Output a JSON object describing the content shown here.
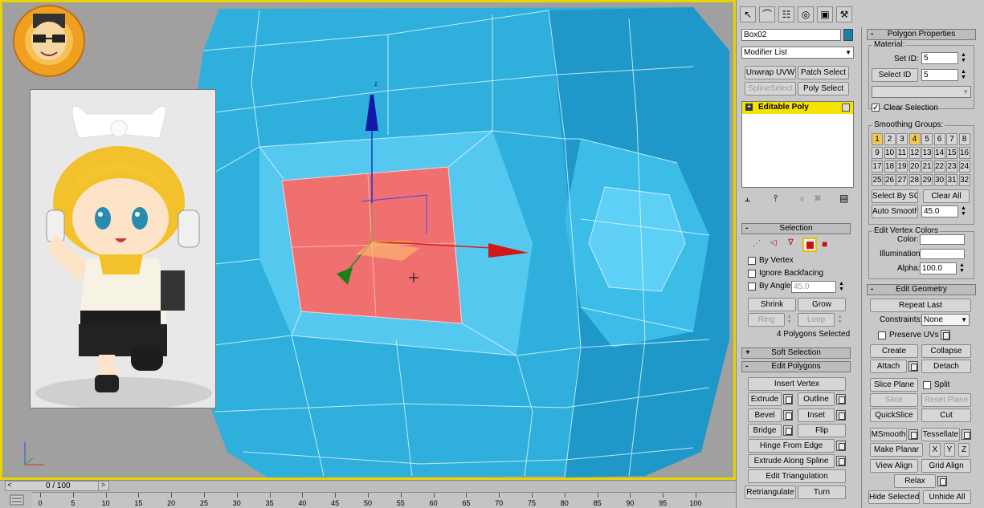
{
  "colors": {
    "mesh": "#2fb0dc",
    "mesh_dark": "#1e8fc0",
    "selected_polys": "#f07070",
    "viewport_border": "#e8d400",
    "object_color": "#1b7fa8",
    "stack_highlight": "#f4e200"
  },
  "timeline": {
    "slider_value": "0 / 100",
    "ticks": [
      "0",
      "5",
      "10",
      "15",
      "20",
      "25",
      "30",
      "35",
      "40",
      "45",
      "50",
      "55",
      "60",
      "65",
      "70",
      "75",
      "80",
      "85",
      "90",
      "95",
      "100"
    ]
  },
  "command_panel": {
    "object_name": "Box02",
    "modifier_list": "Modifier List",
    "buttons": {
      "unwrap_uvw": "Unwrap UVW",
      "patch_select": "Patch Select",
      "spline_select": "SplineSelect",
      "poly_select": "Poly Select"
    },
    "stack_item": "Editable Poly",
    "selection": {
      "title": "Selection",
      "by_vertex": "By Vertex",
      "ignore_backfacing": "Ignore Backfacing",
      "by_angle": "By Angle:",
      "by_angle_value": "45.0",
      "shrink": "Shrink",
      "grow": "Grow",
      "ring": "Ring",
      "loop": "Loop",
      "status": "4 Polygons Selected"
    },
    "soft_selection": "Soft Selection",
    "edit_polygons": {
      "title": "Edit Polygons",
      "insert_vertex": "Insert Vertex",
      "extrude": "Extrude",
      "outline": "Outline",
      "bevel": "Bevel",
      "inset": "Inset",
      "bridge": "Bridge",
      "flip": "Flip",
      "hinge_from_edge": "Hinge From Edge",
      "extrude_along_spline": "Extrude Along Spline",
      "edit_triangulation": "Edit Triangulation",
      "retriangulate": "Retriangulate",
      "turn": "Turn"
    }
  },
  "properties": {
    "polygon_properties": "Polygon Properties",
    "material": "Material:",
    "set_id": "Set ID:",
    "set_id_value": "5",
    "select_id": "Select ID",
    "select_id_value": "5",
    "clear_selection": "Clear Selection",
    "smoothing_groups": "Smoothing Groups:",
    "sg_numbers": [
      "1",
      "2",
      "3",
      "4",
      "5",
      "6",
      "7",
      "8",
      "9",
      "10",
      "11",
      "12",
      "13",
      "14",
      "15",
      "16",
      "17",
      "18",
      "19",
      "20",
      "21",
      "22",
      "23",
      "24",
      "25",
      "26",
      "27",
      "28",
      "29",
      "30",
      "31",
      "32"
    ],
    "sg_active": [
      "1",
      "4"
    ],
    "select_by_sg": "Select By SG",
    "clear_all": "Clear All",
    "auto_smooth": "Auto Smooth",
    "auto_smooth_value": "45.0",
    "edit_vertex_colors": "Edit Vertex Colors",
    "color": "Color:",
    "illumination": "Illumination:",
    "alpha": "Alpha:",
    "alpha_value": "100.0",
    "edit_geometry": "Edit Geometry",
    "repeat_last": "Repeat Last",
    "constraints": "Constraints:",
    "constraints_value": "None",
    "preserve_uvs": "Preserve UVs",
    "create": "Create",
    "collapse": "Collapse",
    "attach": "Attach",
    "detach": "Detach",
    "slice_plane": "Slice Plane",
    "split": "Split",
    "slice": "Slice",
    "reset_plane": "Reset Plane",
    "quickslice": "QuickSlice",
    "cut": "Cut",
    "msmooth": "MSmooth",
    "tessellate": "Tessellate",
    "make_planar": "Make Planar",
    "x": "X",
    "y": "Y",
    "z": "Z",
    "view_align": "View Align",
    "grid_align": "Grid Align",
    "relax": "Relax",
    "hide_selected": "Hide Selected",
    "unhide_all": "Unhide All"
  },
  "viewport": {
    "gizmo_z_label": "z"
  }
}
